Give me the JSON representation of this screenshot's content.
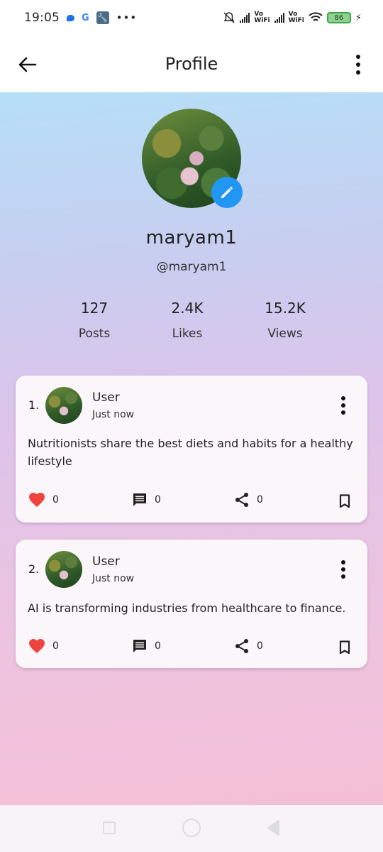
{
  "status_bar": {
    "time": "19:05",
    "more": "•••",
    "g": "G",
    "wrench": "🔧",
    "vo1_top": "Vo",
    "vo1_bottom": "WiFi",
    "vo2_top": "Vo",
    "vo2_bottom": "WiFi",
    "battery": "86",
    "bolt": "⚡",
    "icons": [
      "messages-icon",
      "google-icon",
      "wrench-icon",
      "more-icon",
      "mute-icon",
      "signal-icon",
      "wifi-icon",
      "battery-icon",
      "charging-icon"
    ]
  },
  "app_bar": {
    "title": "Profile",
    "back_icon": "arrow-left-icon",
    "menu_icon": "more-vertical-icon"
  },
  "profile": {
    "username": "maryam1",
    "handle": "@maryam1",
    "stats": [
      {
        "value": "127",
        "label": "Posts"
      },
      {
        "value": "2.4K",
        "label": "Likes"
      },
      {
        "value": "15.2K",
        "label": "Views"
      }
    ]
  },
  "posts": [
    {
      "index": "1.",
      "author": "User",
      "time": "Just now",
      "text": "Nutritionists share the best diets and habits for a healthy lifestyle",
      "likes": "0",
      "comments": "0",
      "shares": "0"
    },
    {
      "index": "2.",
      "author": "User",
      "time": "Just now",
      "text": "AI is transforming industries from healthcare to finance.",
      "likes": "0",
      "comments": "0",
      "shares": "0"
    }
  ],
  "colors": {
    "accent": "#2196f3",
    "heart": "#f0433d",
    "gradient_top": "#b6dff7",
    "gradient_bottom": "#f4bfd6"
  }
}
